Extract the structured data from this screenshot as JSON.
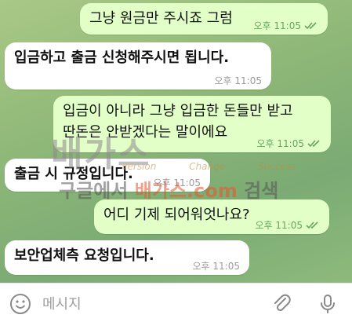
{
  "messages": [
    {
      "dir": "out",
      "text": "그냥 원금만 주시죠 그럼",
      "time": "오후 11:05"
    },
    {
      "dir": "in",
      "text": "입금하고 출금 신청해주시면 됩니다.",
      "time": "오후 11:05"
    },
    {
      "dir": "out",
      "text": "입금이 아니라 그냥 입금한 돈들만 받고\n딴돈은 안받겠다는 말이에요",
      "time": "오후 11:05"
    },
    {
      "dir": "in",
      "text": "출금 시 규정입니다.",
      "time": "오후 11:05"
    },
    {
      "dir": "out",
      "text": "어디 기제 되어워엇나요?",
      "time": "오후 11:05"
    },
    {
      "dir": "in",
      "text": "보안업체측 요청입니다.",
      "time": "오후 11:05"
    }
  ],
  "watermark": {
    "logo": "배가스",
    "tags": "Version Change Success",
    "search_prefix": "구글에서",
    "search_site": "배가스.com",
    "search_suffix": "검색"
  },
  "input": {
    "placeholder": "메시지",
    "value": ""
  },
  "icons": {
    "emoji": "emoji-icon",
    "attach": "paperclip-icon",
    "mic": "microphone-icon",
    "read": "double-check-icon"
  },
  "colors": {
    "outgoing_bubble": "#e1ffc7",
    "incoming_bubble": "#ffffff",
    "read_check": "#6aa35f"
  }
}
